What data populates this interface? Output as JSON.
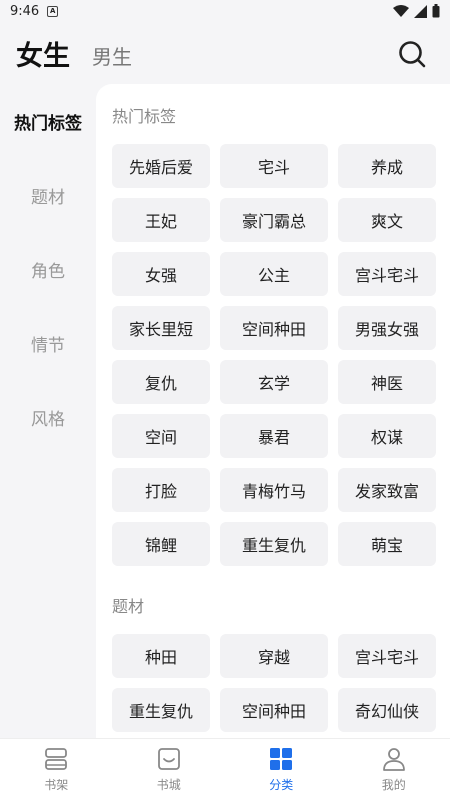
{
  "status": {
    "time": "9:46",
    "notif": "A"
  },
  "header": {
    "tab_active": "女生",
    "tab_inactive": "男生"
  },
  "sidebar": {
    "items": [
      {
        "label": "热门标签",
        "active": true
      },
      {
        "label": "题材"
      },
      {
        "label": "角色"
      },
      {
        "label": "情节"
      },
      {
        "label": "风格"
      }
    ]
  },
  "sections": [
    {
      "title": "热门标签",
      "tags": [
        "先婚后爱",
        "宅斗",
        "养成",
        "王妃",
        "豪门霸总",
        "爽文",
        "女强",
        "公主",
        "宫斗宅斗",
        "家长里短",
        "空间种田",
        "男强女强",
        "复仇",
        "玄学",
        "神医",
        "空间",
        "暴君",
        "权谋",
        "打脸",
        "青梅竹马",
        "发家致富",
        "锦鲤",
        "重生复仇",
        "萌宝"
      ]
    },
    {
      "title": "题材",
      "tags": [
        "种田",
        "穿越",
        "宫斗宅斗",
        "重生复仇",
        "空间种田",
        "奇幻仙侠"
      ]
    }
  ],
  "bottom_nav": [
    {
      "label": "书架",
      "icon": "bookshelf-icon"
    },
    {
      "label": "书城",
      "icon": "bookstore-icon"
    },
    {
      "label": "分类",
      "icon": "category-icon",
      "active": true
    },
    {
      "label": "我的",
      "icon": "profile-icon"
    }
  ],
  "colors": {
    "accent": "#1f6fea",
    "tag_bg": "#f2f2f4",
    "page_bg": "#f5f5f7"
  }
}
